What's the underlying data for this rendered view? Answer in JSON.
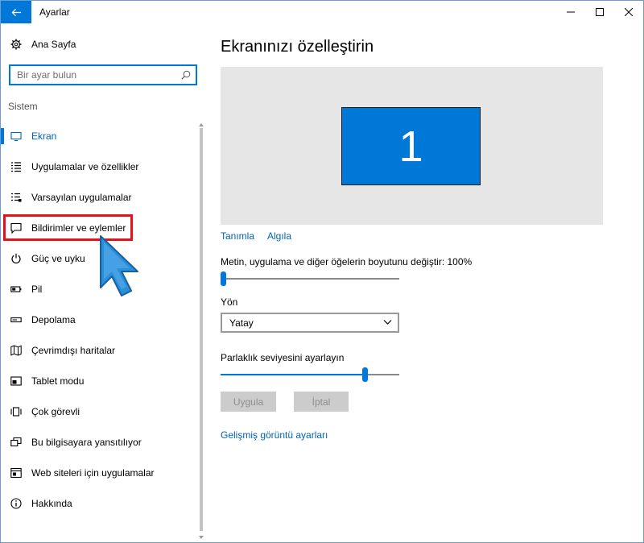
{
  "window": {
    "title": "Ayarlar"
  },
  "sidebar": {
    "home_label": "Ana Sayfa",
    "search_placeholder": "Bir ayar bulun",
    "section_label": "Sistem",
    "items": [
      {
        "label": "Ekran",
        "icon": "monitor-icon",
        "active": true
      },
      {
        "label": "Uygulamalar ve özellikler",
        "icon": "list-icon"
      },
      {
        "label": "Varsayılan uygulamalar",
        "icon": "default-apps-icon"
      },
      {
        "label": "Bildirimler ve eylemler",
        "icon": "notification-icon"
      },
      {
        "label": "Güç ve uyku",
        "icon": "power-icon"
      },
      {
        "label": "Pil",
        "icon": "battery-icon"
      },
      {
        "label": "Depolama",
        "icon": "storage-icon"
      },
      {
        "label": "Çevrimdışı haritalar",
        "icon": "map-icon"
      },
      {
        "label": "Tablet modu",
        "icon": "tablet-icon"
      },
      {
        "label": "Çok görevli",
        "icon": "multitask-icon"
      },
      {
        "label": "Bu bilgisayara yansıtılıyor",
        "icon": "project-icon"
      },
      {
        "label": "Web siteleri için uygulamalar",
        "icon": "web-apps-icon"
      },
      {
        "label": "Hakkında",
        "icon": "info-icon"
      }
    ]
  },
  "main": {
    "title": "Ekranınızı özelleştirin",
    "monitor_number": "1",
    "identify_link": "Tanımla",
    "detect_link": "Algıla",
    "scale_label": "Metin, uygulama ve diğer öğelerin boyutunu değiştir: 100%",
    "scale_value": 0.0,
    "orientation_label": "Yön",
    "orientation_value": "Yatay",
    "brightness_label": "Parlaklık seviyesini ayarlayın",
    "brightness_value": 0.82,
    "apply_button": "Uygula",
    "cancel_button": "İptal",
    "advanced_link": "Gelişmiş görüntü ayarları"
  },
  "colors": {
    "accent": "#0078d7",
    "highlight_box": "#e0141e"
  }
}
